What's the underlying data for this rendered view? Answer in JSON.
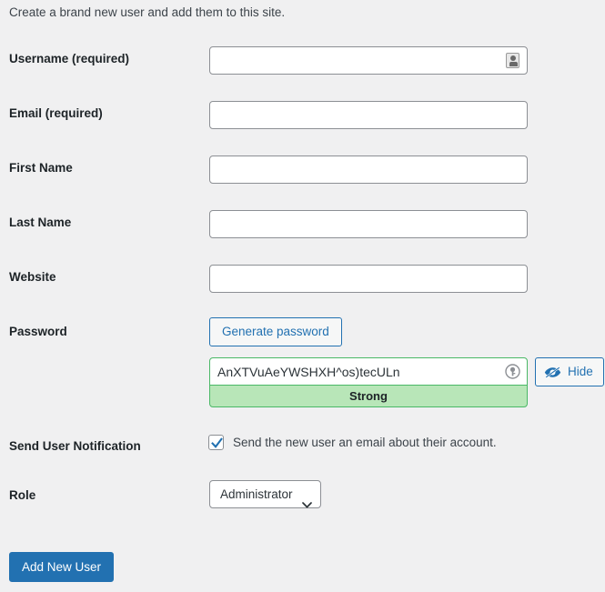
{
  "page": {
    "intro_text": "Create a brand new user and add them to this site."
  },
  "fields": {
    "username": {
      "label": "Username",
      "required_suffix": " (required)",
      "value": "",
      "icon": "contact-card-autofill-icon"
    },
    "email": {
      "label": "Email",
      "required_suffix": " (required)",
      "value": ""
    },
    "first_name": {
      "label": "First Name",
      "value": ""
    },
    "last_name": {
      "label": "Last Name",
      "value": ""
    },
    "website": {
      "label": "Website",
      "value": ""
    }
  },
  "password": {
    "label": "Password",
    "generate_button_label": "Generate password",
    "value": "AnXTVuAeYWSHXH^os)tecULn",
    "strength_text": "Strong",
    "strength_color": "#b8e6b8",
    "strength_border_color": "#4ab866",
    "hide_button_label": "Hide",
    "hide_icon": "eye-slash-icon",
    "field_icon": "password-key-icon"
  },
  "notification": {
    "label": "Send User Notification",
    "checkbox_label": "Send the new user an email about their account.",
    "checked": true
  },
  "role": {
    "label": "Role",
    "selected": "Administrator",
    "options": [
      "Administrator"
    ]
  },
  "submit": {
    "label": "Add New User"
  },
  "colors": {
    "accent": "#2271b1",
    "background": "#f0f0f1",
    "label_text": "#1d2327",
    "body_text": "#3c434a",
    "input_border": "#8c8f94"
  }
}
